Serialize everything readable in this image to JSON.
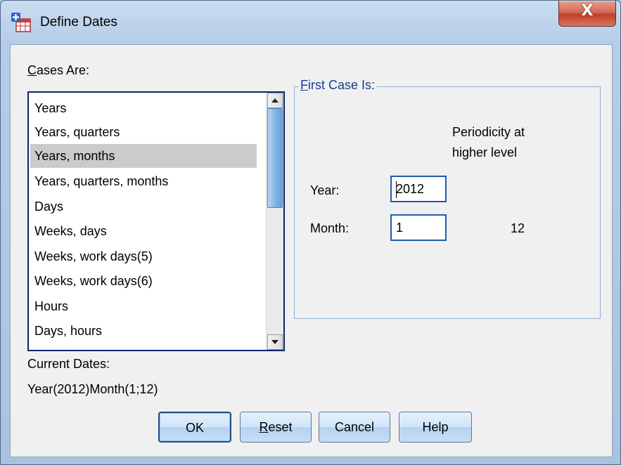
{
  "window": {
    "title": "Define Dates",
    "close_label": "X"
  },
  "cases": {
    "label_prefix": "C",
    "label_rest": "ases Are:",
    "items": [
      "Years",
      "Years, quarters",
      "Years, months",
      "Years, quarters, months",
      "Days",
      "Weeks, days",
      "Weeks, work days(5)",
      "Weeks, work days(6)",
      "Hours",
      "Days, hours"
    ],
    "selected": "Years, months"
  },
  "first_case": {
    "legend_prefix": "F",
    "legend_rest": "irst Case Is:",
    "periodicity_header_line1": "Periodicity at",
    "periodicity_header_line2": "higher level",
    "year_label": "Year:",
    "year_value": "2012",
    "month_label": "Month:",
    "month_value": "1",
    "month_periodicity": "12"
  },
  "current_dates": {
    "label": "Current Dates:",
    "value": "Year(2012)Month(1;12)"
  },
  "buttons": {
    "ok": "OK",
    "reset_prefix": "R",
    "reset_rest": "eset",
    "cancel": "Cancel",
    "help": "Help"
  }
}
